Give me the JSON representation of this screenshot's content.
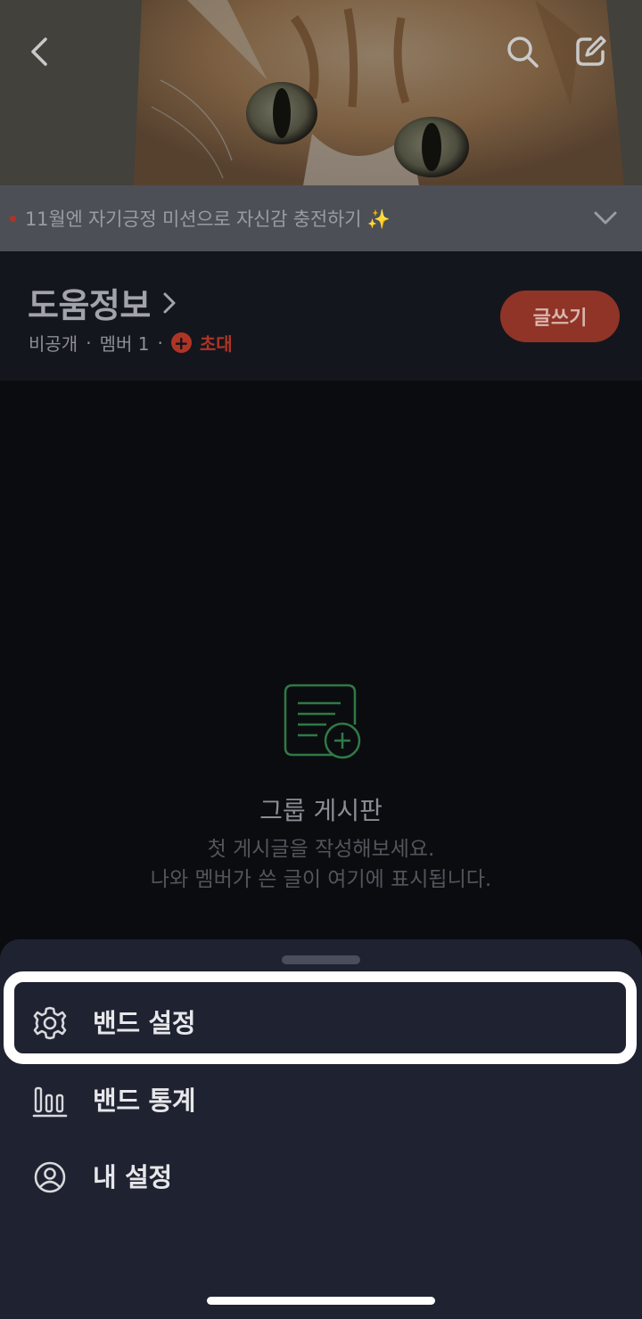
{
  "header": {
    "back_icon": "chevron-left-icon",
    "search_icon": "search-icon",
    "write_icon": "edit-icon"
  },
  "notice": {
    "text": "11월엔 자기긍정 미션으로 자신감 충전하기 ✨",
    "expand_icon": "chevron-down-icon"
  },
  "band": {
    "name": "도움정보",
    "visibility": "비공개",
    "members": "멤버 1",
    "invite_label": "초대",
    "post_button": "글쓰기"
  },
  "empty_state": {
    "title": "그룹 게시판",
    "line1": "첫 게시글을 작성해보세요.",
    "line2": "나와 멤버가 쓴 글이 여기에 표시됩니다."
  },
  "sheet": {
    "items": [
      {
        "label": "밴드 설정",
        "icon": "gear-icon"
      },
      {
        "label": "밴드 통계",
        "icon": "bar-chart-icon"
      },
      {
        "label": "내 설정",
        "icon": "user-circle-icon"
      }
    ]
  },
  "colors": {
    "accent": "#b03426",
    "sheet_bg": "#1f2230",
    "empty_icon": "#2f7a45"
  }
}
